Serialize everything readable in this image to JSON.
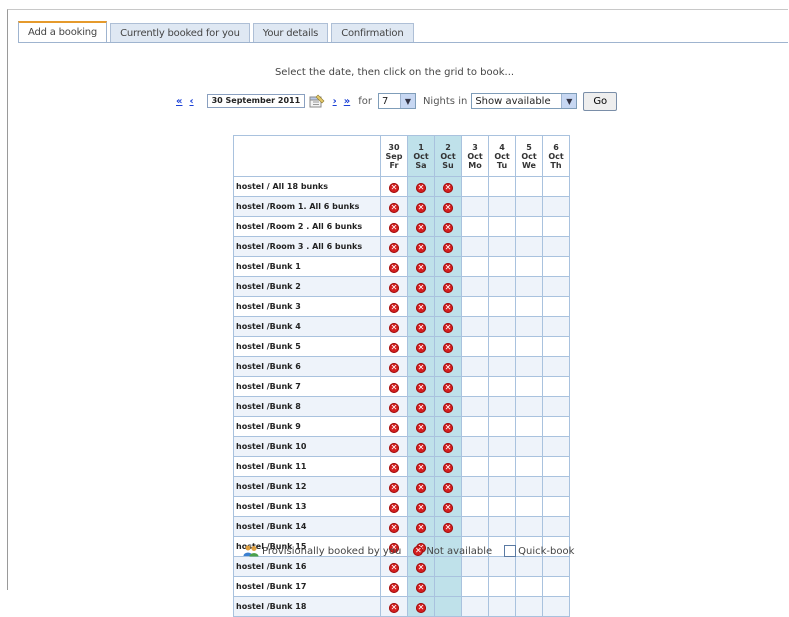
{
  "tabs": [
    {
      "label": "Add a booking",
      "active": true
    },
    {
      "label": "Currently booked for you",
      "active": false
    },
    {
      "label": "Your details",
      "active": false
    },
    {
      "label": "Confirmation",
      "active": false
    }
  ],
  "instruction": "Select the date, then click on the grid to book...",
  "nav": {
    "first_label": "«",
    "prev_label": "‹",
    "date_value": "30 September 2011",
    "next_label": "›",
    "last_label": "»",
    "for_label": "for",
    "nights_value": "7",
    "nights_in_label": "Nights in",
    "filter_value": "Show available",
    "go_label": "Go"
  },
  "grid": {
    "columns": [
      {
        "day": "30",
        "month": "Sep",
        "weekday": "Fr",
        "weekend": false
      },
      {
        "day": "1",
        "month": "Oct",
        "weekday": "Sa",
        "weekend": true
      },
      {
        "day": "2",
        "month": "Oct",
        "weekday": "Su",
        "weekend": true
      },
      {
        "day": "3",
        "month": "Oct",
        "weekday": "Mo",
        "weekend": false
      },
      {
        "day": "4",
        "month": "Oct",
        "weekday": "Tu",
        "weekend": false
      },
      {
        "day": "5",
        "month": "Oct",
        "weekday": "We",
        "weekend": false
      },
      {
        "day": "6",
        "month": "Oct",
        "weekday": "Th",
        "weekend": false
      }
    ],
    "rows": [
      {
        "room": "hostel / All 18 bunks",
        "status": [
          "x",
          "x",
          "x",
          "",
          "",
          "",
          ""
        ]
      },
      {
        "room": "hostel /Room 1. All 6 bunks",
        "status": [
          "x",
          "x",
          "x",
          "",
          "",
          "",
          ""
        ]
      },
      {
        "room": "hostel /Room 2 . All 6 bunks",
        "status": [
          "x",
          "x",
          "x",
          "",
          "",
          "",
          ""
        ]
      },
      {
        "room": "hostel /Room 3 . All 6 bunks",
        "status": [
          "x",
          "x",
          "x",
          "",
          "",
          "",
          ""
        ]
      },
      {
        "room": "hostel /Bunk 1",
        "status": [
          "x",
          "x",
          "x",
          "",
          "",
          "",
          ""
        ]
      },
      {
        "room": "hostel /Bunk 2",
        "status": [
          "x",
          "x",
          "x",
          "",
          "",
          "",
          ""
        ]
      },
      {
        "room": "hostel /Bunk 3",
        "status": [
          "x",
          "x",
          "x",
          "",
          "",
          "",
          ""
        ]
      },
      {
        "room": "hostel /Bunk 4",
        "status": [
          "x",
          "x",
          "x",
          "",
          "",
          "",
          ""
        ]
      },
      {
        "room": "hostel /Bunk 5",
        "status": [
          "x",
          "x",
          "x",
          "",
          "",
          "",
          ""
        ]
      },
      {
        "room": "hostel /Bunk 6",
        "status": [
          "x",
          "x",
          "x",
          "",
          "",
          "",
          ""
        ]
      },
      {
        "room": "hostel /Bunk 7",
        "status": [
          "x",
          "x",
          "x",
          "",
          "",
          "",
          ""
        ]
      },
      {
        "room": "hostel /Bunk 8",
        "status": [
          "x",
          "x",
          "x",
          "",
          "",
          "",
          ""
        ]
      },
      {
        "room": "hostel /Bunk 9",
        "status": [
          "x",
          "x",
          "x",
          "",
          "",
          "",
          ""
        ]
      },
      {
        "room": "hostel /Bunk 10",
        "status": [
          "x",
          "x",
          "x",
          "",
          "",
          "",
          ""
        ]
      },
      {
        "room": "hostel /Bunk 11",
        "status": [
          "x",
          "x",
          "x",
          "",
          "",
          "",
          ""
        ]
      },
      {
        "room": "hostel /Bunk 12",
        "status": [
          "x",
          "x",
          "x",
          "",
          "",
          "",
          ""
        ]
      },
      {
        "room": "hostel /Bunk 13",
        "status": [
          "x",
          "x",
          "x",
          "",
          "",
          "",
          ""
        ]
      },
      {
        "room": "hostel /Bunk 14",
        "status": [
          "x",
          "x",
          "x",
          "",
          "",
          "",
          ""
        ]
      },
      {
        "room": "hostel /Bunk 15",
        "status": [
          "x",
          "x",
          "",
          "",
          "",
          "",
          ""
        ]
      },
      {
        "room": "hostel /Bunk 16",
        "status": [
          "x",
          "x",
          "",
          "",
          "",
          "",
          ""
        ]
      },
      {
        "room": "hostel /Bunk 17",
        "status": [
          "x",
          "x",
          "",
          "",
          "",
          "",
          ""
        ]
      },
      {
        "room": "hostel /Bunk 18",
        "status": [
          "x",
          "x",
          "",
          "",
          "",
          "",
          ""
        ]
      }
    ]
  },
  "legend": {
    "provisional_label": "Provisionally booked by you",
    "not_available_label": "Not available",
    "quickbook_label": "Quick-book"
  },
  "colors": {
    "weekend_column": "#bfe1ea",
    "not_available": "#d51f1f",
    "link": "#1a3fd6",
    "active_tab_accent": "#e59a2c"
  }
}
